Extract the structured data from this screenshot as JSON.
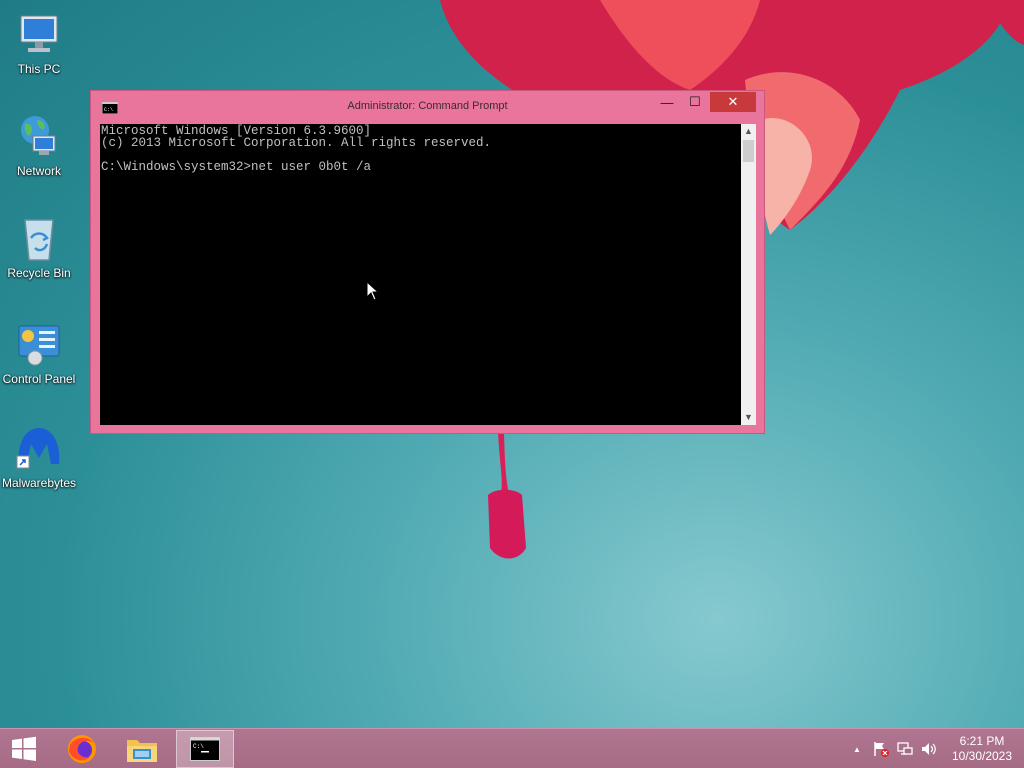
{
  "desktop": {
    "icons": [
      {
        "label": "This PC",
        "icon": "this-pc-icon"
      },
      {
        "label": "Network",
        "icon": "network-icon"
      },
      {
        "label": "Recycle Bin",
        "icon": "recycle-bin-icon"
      },
      {
        "label": "Control Panel",
        "icon": "control-panel-icon"
      },
      {
        "label": "Malwarebytes",
        "icon": "malwarebytes-icon"
      }
    ]
  },
  "window": {
    "title": "Administrator: Command Prompt",
    "controls": {
      "minimize": "—",
      "maximize": "☐",
      "close": "✕"
    },
    "console_lines": [
      "Microsoft Windows [Version 6.3.9600]",
      "(c) 2013 Microsoft Corporation. All rights reserved.",
      "",
      "C:\\Windows\\system32>net user 0b0t /a"
    ],
    "scroll": {
      "up": "▲",
      "down": "▼"
    }
  },
  "taskbar": {
    "start": "start-icon",
    "apps": [
      "firefox-icon",
      "file-explorer-icon",
      "command-prompt-icon"
    ],
    "tray": {
      "show_hidden": "▲",
      "icons": [
        "action-center-flag-icon",
        "network-tray-icon",
        "volume-icon"
      ]
    },
    "clock": {
      "time": "6:21 PM",
      "date": "10/30/2023"
    }
  },
  "colors": {
    "window_frame": "#e9759d",
    "close_button": "#c7393a",
    "taskbar": "#a66c86",
    "desktop": "#2c8f98"
  }
}
